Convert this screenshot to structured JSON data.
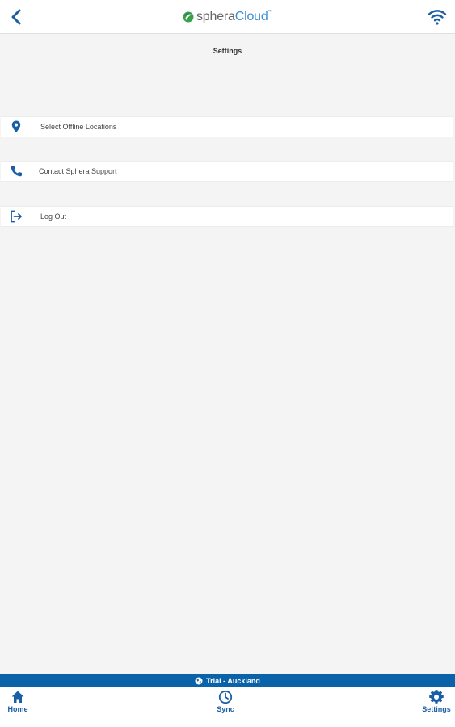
{
  "header": {
    "logo_part1": "sphera",
    "logo_part2": "Cloud",
    "logo_tm": "™"
  },
  "page": {
    "title": "Settings"
  },
  "menu": {
    "items": [
      {
        "label": "Select Offline Locations",
        "icon": "map-pin-icon"
      },
      {
        "label": "Contact Sphera Support",
        "icon": "phone-icon"
      },
      {
        "label": "Log Out",
        "icon": "logout-icon"
      }
    ]
  },
  "trial_bar": {
    "text": "Trial - Auckland"
  },
  "tabbar": {
    "tabs": [
      {
        "label": "Home",
        "icon": "home-icon"
      },
      {
        "label": "Sync",
        "icon": "clock-icon"
      },
      {
        "label": "Settings",
        "icon": "gear-icon"
      }
    ]
  },
  "colors": {
    "accent": "#1a5fa5",
    "bar": "#0a63a8",
    "logo_green": "#3aa04a",
    "logo_blue": "#3d8fd1",
    "background": "#f4f4f4"
  }
}
